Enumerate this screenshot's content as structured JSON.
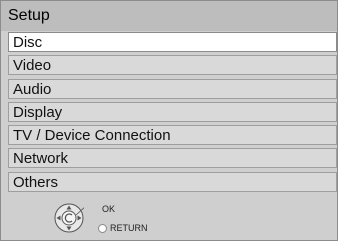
{
  "title": "Setup",
  "menu": {
    "items": [
      {
        "label": "Disc",
        "selected": true
      },
      {
        "label": "Video",
        "selected": false
      },
      {
        "label": "Audio",
        "selected": false
      },
      {
        "label": "Display",
        "selected": false
      },
      {
        "label": "TV / Device Connection",
        "selected": false
      },
      {
        "label": "Network",
        "selected": false
      },
      {
        "label": "Others",
        "selected": false
      }
    ]
  },
  "footer": {
    "ok_label": "OK",
    "return_label": "RETURN",
    "dpad_icon": "dpad-icon",
    "return_icon": "return-button-icon"
  }
}
